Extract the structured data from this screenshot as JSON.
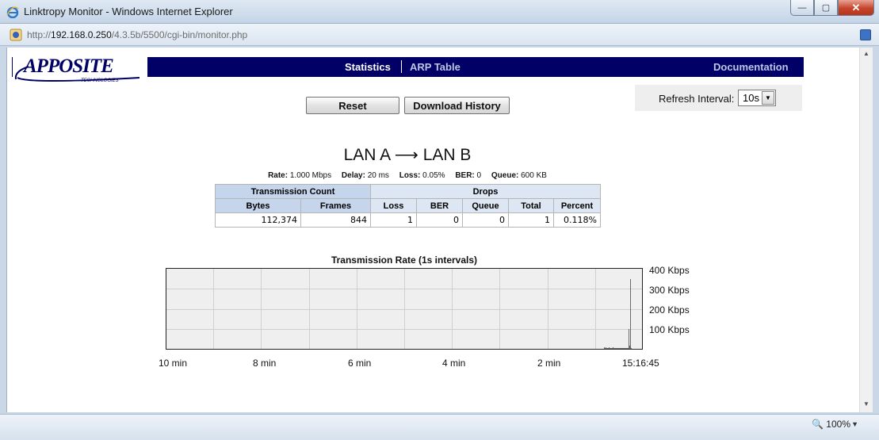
{
  "window": {
    "title": "Linktropy Monitor - Windows Internet Explorer",
    "minimize_glyph": "—",
    "maximize_glyph": "▢",
    "close_glyph": "✕"
  },
  "address": {
    "prefix": "http://",
    "host": "192.168.0.250",
    "path": "/4.3.5b/5500/cgi-bin/monitor.php"
  },
  "header": {
    "logo_text": "APPOSITE",
    "logo_subtext": "TECHNOLOGIES",
    "nav": {
      "statistics": "Statistics",
      "arp_table": "ARP Table",
      "documentation": "Documentation"
    }
  },
  "controls": {
    "reset_label": "Reset",
    "download_label": "Download History",
    "refresh_label": "Refresh Interval:",
    "refresh_value": "10s"
  },
  "link": {
    "heading": "LAN A ⟶ LAN B",
    "params": {
      "rate_label": "Rate:",
      "rate": "1.000 Mbps",
      "delay_label": "Delay:",
      "delay": "20 ms",
      "loss_label": "Loss:",
      "loss": "0.05%",
      "ber_label": "BER:",
      "ber": "0",
      "queue_label": "Queue:",
      "queue": "600 KB"
    }
  },
  "stats_table": {
    "group_transmission": "Transmission Count",
    "group_drops": "Drops",
    "columns": [
      "Bytes",
      "Frames",
      "Loss",
      "BER",
      "Queue",
      "Total",
      "Percent"
    ],
    "row": [
      "112,374",
      "844",
      "1",
      "0",
      "0",
      "1",
      "0.118%"
    ]
  },
  "chart_data": {
    "type": "bar",
    "title": "Transmission Rate (1s intervals)",
    "y_labels": [
      "400 Kbps",
      "300 Kbps",
      "200 Kbps",
      "100 Kbps"
    ],
    "x_labels": [
      "10 min",
      "8 min",
      "6 min",
      "4 min",
      "2 min",
      "15:16:45"
    ],
    "ylim": [
      0,
      400
    ],
    "x_unit": "seconds",
    "grid": true,
    "values": [
      7,
      4,
      6,
      3,
      5,
      4,
      6,
      3,
      5,
      2,
      4,
      6,
      3,
      5,
      4,
      3,
      5,
      2,
      4,
      3,
      5,
      3,
      4,
      2,
      3,
      4,
      3,
      5,
      3,
      4,
      3,
      100,
      15,
      350,
      3
    ],
    "bar_color": "#6a6a6a"
  },
  "status": {
    "zoom": "100%"
  }
}
